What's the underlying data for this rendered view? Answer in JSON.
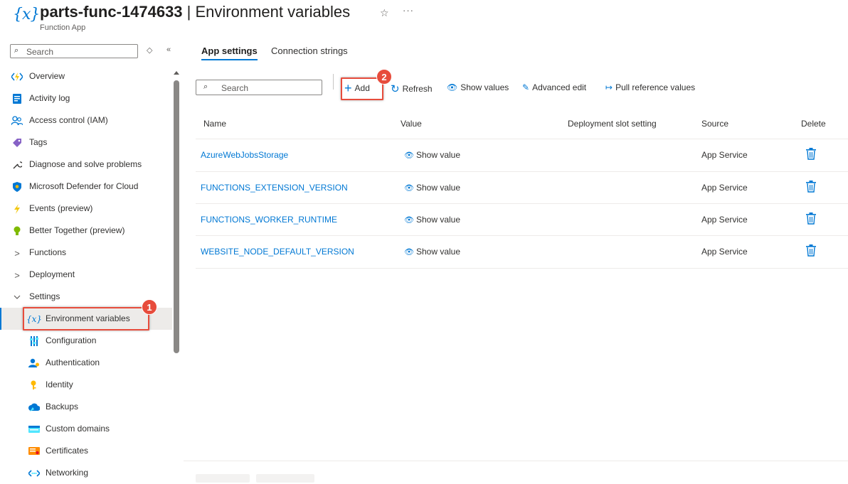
{
  "header": {
    "icon": "function-variable-icon",
    "title_bold": "parts-func-1474633",
    "title_rest": " | Environment variables",
    "subtitle": "Function App"
  },
  "nav": {
    "search_placeholder": "Search",
    "items": [
      {
        "label": "Overview",
        "icon": "lightning-code-icon"
      },
      {
        "label": "Activity log",
        "icon": "activity-log-icon"
      },
      {
        "label": "Access control (IAM)",
        "icon": "people-icon"
      },
      {
        "label": "Tags",
        "icon": "tag-icon"
      },
      {
        "label": "Diagnose and solve problems",
        "icon": "wrench-icon"
      },
      {
        "label": "Microsoft Defender for Cloud",
        "icon": "shield-icon"
      },
      {
        "label": "Events (preview)",
        "icon": "lightning-icon"
      },
      {
        "label": "Better Together (preview)",
        "icon": "bulb-icon"
      },
      {
        "label": "Functions",
        "icon": "chevron-right-icon"
      },
      {
        "label": "Deployment",
        "icon": "chevron-right-icon"
      },
      {
        "label": "Settings",
        "icon": "chevron-down-icon"
      },
      {
        "label": "Environment variables",
        "icon": "function-variable-icon"
      },
      {
        "label": "Configuration",
        "icon": "sliders-icon"
      },
      {
        "label": "Authentication",
        "icon": "user-key-icon"
      },
      {
        "label": "Identity",
        "icon": "key-icon"
      },
      {
        "label": "Backups",
        "icon": "cloud-backup-icon"
      },
      {
        "label": "Custom domains",
        "icon": "globe-card-icon"
      },
      {
        "label": "Certificates",
        "icon": "certificate-icon"
      },
      {
        "label": "Networking",
        "icon": "network-icon"
      }
    ]
  },
  "tabs": [
    {
      "label": "App settings",
      "active": true
    },
    {
      "label": "Connection strings",
      "active": false
    }
  ],
  "toolbar": {
    "search_placeholder": "Search",
    "add": "Add",
    "refresh": "Refresh",
    "show_values": "Show values",
    "advanced_edit": "Advanced edit",
    "pull_reference": "Pull reference values"
  },
  "table": {
    "headers": {
      "name": "Name",
      "value": "Value",
      "slot": "Deployment slot setting",
      "source": "Source",
      "delete": "Delete"
    },
    "rows": [
      {
        "name": "AzureWebJobsStorage",
        "value": "Show value",
        "source": "App Service"
      },
      {
        "name": "FUNCTIONS_EXTENSION_VERSION",
        "value": "Show value",
        "source": "App Service"
      },
      {
        "name": "FUNCTIONS_WORKER_RUNTIME",
        "value": "Show value",
        "source": "App Service"
      },
      {
        "name": "WEBSITE_NODE_DEFAULT_VERSION",
        "value": "Show value",
        "source": "App Service"
      }
    ]
  },
  "callouts": [
    "1",
    "2"
  ],
  "colors": {
    "accent": "#0078d4",
    "callout": "#e74c3c"
  }
}
